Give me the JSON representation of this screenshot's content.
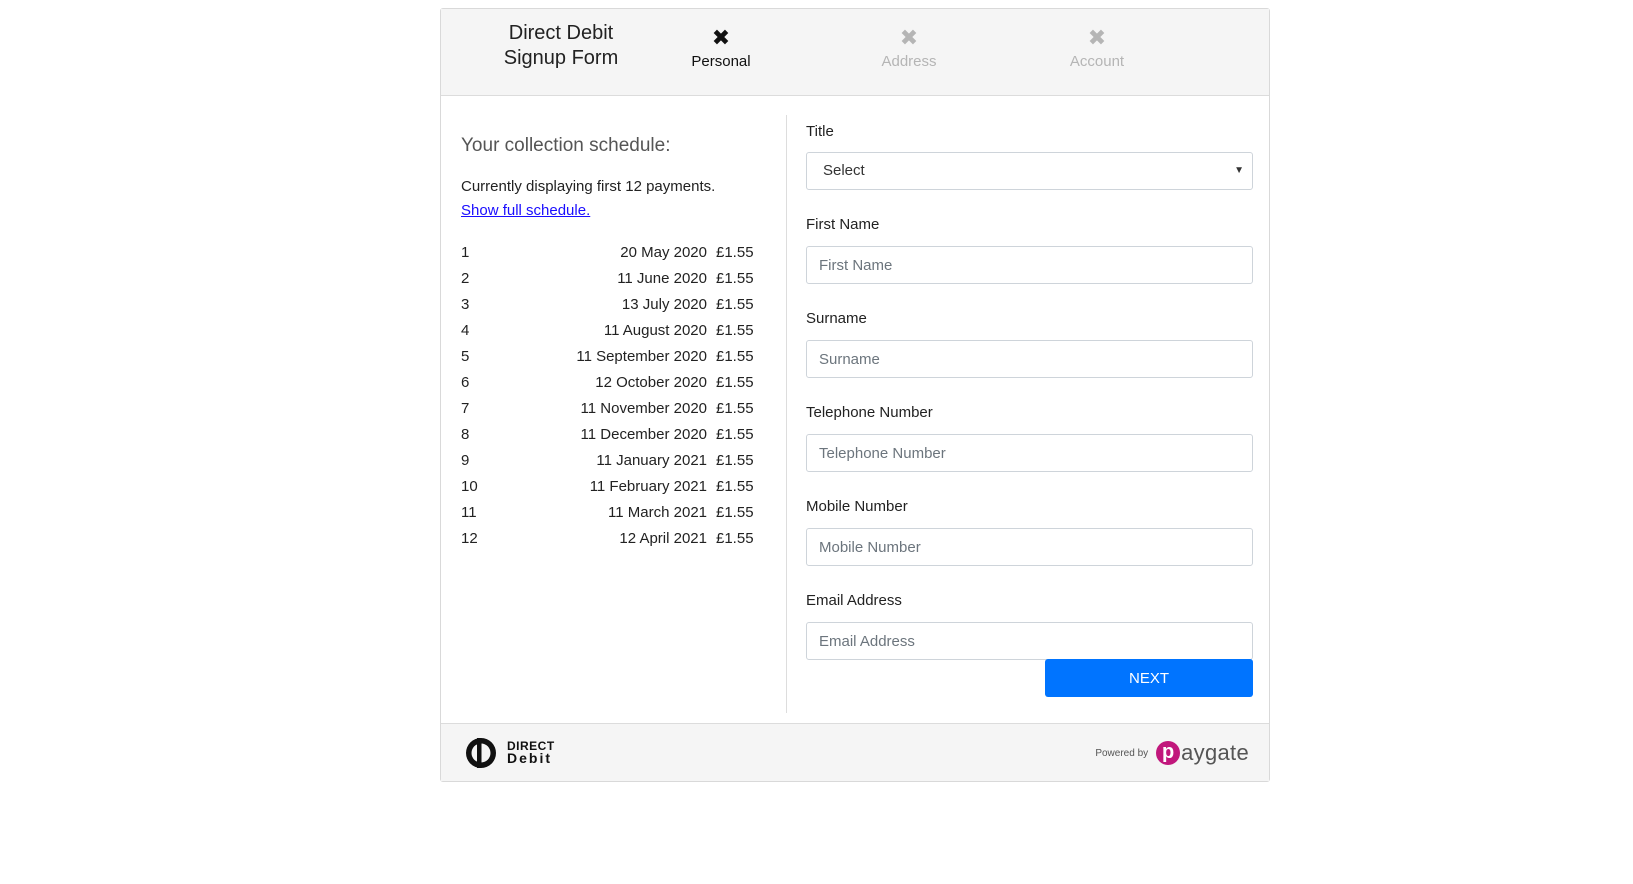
{
  "header": {
    "title_line1": "Direct Debit",
    "title_line2": "Signup Form",
    "steps": [
      {
        "label": "Personal",
        "mark": "✖",
        "state": "active"
      },
      {
        "label": "Address",
        "mark": "✖",
        "state": "inactive"
      },
      {
        "label": "Account",
        "mark": "✖",
        "state": "inactive"
      }
    ]
  },
  "schedule": {
    "heading": "Your collection schedule:",
    "note": "Currently displaying first 12 payments.",
    "link": "Show full schedule.",
    "rows": [
      {
        "num": "1",
        "date": "20 May 2020",
        "amount": "£1.55"
      },
      {
        "num": "2",
        "date": "11 June 2020",
        "amount": "£1.55"
      },
      {
        "num": "3",
        "date": "13 July 2020",
        "amount": "£1.55"
      },
      {
        "num": "4",
        "date": "11 August 2020",
        "amount": "£1.55"
      },
      {
        "num": "5",
        "date": "11 September 2020",
        "amount": "£1.55"
      },
      {
        "num": "6",
        "date": "12 October 2020",
        "amount": "£1.55"
      },
      {
        "num": "7",
        "date": "11 November 2020",
        "amount": "£1.55"
      },
      {
        "num": "8",
        "date": "11 December 2020",
        "amount": "£1.55"
      },
      {
        "num": "9",
        "date": "11 January 2021",
        "amount": "£1.55"
      },
      {
        "num": "10",
        "date": "11 February 2021",
        "amount": "£1.55"
      },
      {
        "num": "11",
        "date": "11 March 2021",
        "amount": "£1.55"
      },
      {
        "num": "12",
        "date": "12 April 2021",
        "amount": "£1.55"
      }
    ]
  },
  "form": {
    "title": {
      "label": "Title",
      "selected": "Select"
    },
    "first_name": {
      "label": "First Name",
      "placeholder": "First Name",
      "value": ""
    },
    "surname": {
      "label": "Surname",
      "placeholder": "Surname",
      "value": ""
    },
    "telephone": {
      "label": "Telephone Number",
      "placeholder": "Telephone Number",
      "value": ""
    },
    "mobile": {
      "label": "Mobile Number",
      "placeholder": "Mobile Number",
      "value": ""
    },
    "email": {
      "label": "Email Address",
      "placeholder": "Email Address",
      "value": ""
    },
    "next_label": "NEXT"
  },
  "footer": {
    "dd_logo_line1": "DIRECT",
    "dd_logo_line2": "Debit",
    "powered_by": "Powered by",
    "paygate_p": "p",
    "paygate_rest": "aygate"
  },
  "colors": {
    "primary_button": "#0074ff",
    "paygate_brand": "#c1177c",
    "link": "#1a0dff"
  }
}
